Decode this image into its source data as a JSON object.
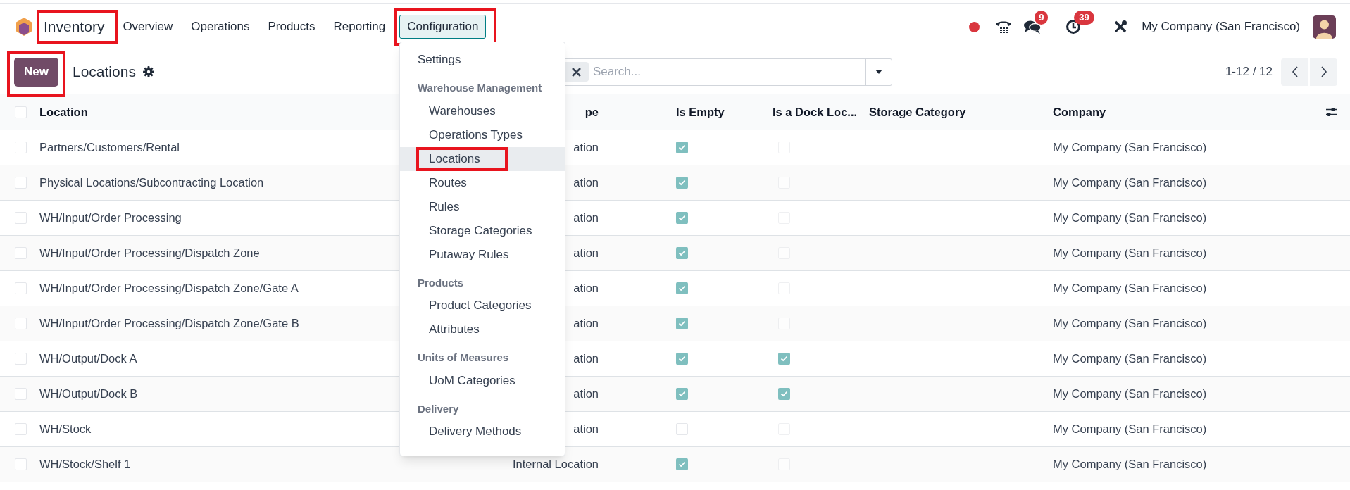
{
  "app": {
    "name": "Inventory",
    "highlighted": true
  },
  "nav": [
    {
      "label": "Overview",
      "selected": false,
      "highlighted": false
    },
    {
      "label": "Operations",
      "selected": false,
      "highlighted": false
    },
    {
      "label": "Products",
      "selected": false,
      "highlighted": false
    },
    {
      "label": "Reporting",
      "selected": false,
      "highlighted": false
    },
    {
      "label": "Configuration",
      "selected": true,
      "highlighted": true
    }
  ],
  "systray": {
    "chat_badge": "9",
    "activity_badge": "39",
    "company": "My Company (San Francisco)"
  },
  "control_panel": {
    "new_button": {
      "label": "New",
      "highlighted": true
    },
    "title": "Locations",
    "search": {
      "placeholder": "Search..."
    },
    "pager": "1-12 / 12"
  },
  "table": {
    "all_selected": false,
    "columns": [
      "Location",
      "pe",
      "Is Empty",
      "Is a Dock Loc...",
      "Storage Category",
      "Company"
    ],
    "rows": [
      {
        "selected": false,
        "location": "Partners/Customers/Rental",
        "type": "ation",
        "is_empty": true,
        "is_dock": false,
        "company": "My Company (San Francisco)"
      },
      {
        "selected": false,
        "location": "Physical Locations/Subcontracting Location",
        "type": "ation",
        "is_empty": true,
        "is_dock": false,
        "company": "My Company (San Francisco)"
      },
      {
        "selected": false,
        "location": "WH/Input/Order Processing",
        "type": "ation",
        "is_empty": true,
        "is_dock": false,
        "company": "My Company (San Francisco)"
      },
      {
        "selected": false,
        "location": "WH/Input/Order Processing/Dispatch Zone",
        "type": "ation",
        "is_empty": true,
        "is_dock": false,
        "company": "My Company (San Francisco)"
      },
      {
        "selected": false,
        "location": "WH/Input/Order Processing/Dispatch Zone/Gate A",
        "type": "ation",
        "is_empty": true,
        "is_dock": false,
        "company": "My Company (San Francisco)"
      },
      {
        "selected": false,
        "location": "WH/Input/Order Processing/Dispatch Zone/Gate B",
        "type": "ation",
        "is_empty": true,
        "is_dock": false,
        "company": "My Company (San Francisco)"
      },
      {
        "selected": false,
        "location": "WH/Output/Dock A",
        "type": "ation",
        "is_empty": true,
        "is_dock": true,
        "company": "My Company (San Francisco)"
      },
      {
        "selected": false,
        "location": "WH/Output/Dock B",
        "type": "ation",
        "is_empty": true,
        "is_dock": true,
        "company": "My Company (San Francisco)"
      },
      {
        "selected": false,
        "location": "WH/Stock",
        "type": "ation",
        "is_empty": false,
        "is_dock": false,
        "company": "My Company (San Francisco)"
      },
      {
        "selected": false,
        "location": "WH/Stock/Shelf 1",
        "type": "Internal Location",
        "is_empty": true,
        "is_dock": false,
        "company": "My Company (San Francisco)"
      }
    ]
  },
  "config_menu": {
    "items": [
      {
        "kind": "item",
        "label": "Settings",
        "selected": false,
        "highlighted": false
      },
      {
        "kind": "header",
        "label": "Warehouse Management"
      },
      {
        "kind": "subitem",
        "label": "Warehouses",
        "selected": false,
        "highlighted": false
      },
      {
        "kind": "subitem",
        "label": "Operations Types",
        "selected": false,
        "highlighted": false
      },
      {
        "kind": "subitem",
        "label": "Locations",
        "selected": true,
        "highlighted": true
      },
      {
        "kind": "subitem",
        "label": "Routes",
        "selected": false,
        "highlighted": false
      },
      {
        "kind": "subitem",
        "label": "Rules",
        "selected": false,
        "highlighted": false
      },
      {
        "kind": "subitem",
        "label": "Storage Categories",
        "selected": false,
        "highlighted": false
      },
      {
        "kind": "subitem",
        "label": "Putaway Rules",
        "selected": false,
        "highlighted": false
      },
      {
        "kind": "header",
        "label": "Products"
      },
      {
        "kind": "subitem",
        "label": "Product Categories",
        "selected": false,
        "highlighted": false
      },
      {
        "kind": "subitem",
        "label": "Attributes",
        "selected": false,
        "highlighted": false
      },
      {
        "kind": "header",
        "label": "Units of Measures"
      },
      {
        "kind": "subitem",
        "label": "UoM Categories",
        "selected": false,
        "highlighted": false
      },
      {
        "kind": "header",
        "label": "Delivery"
      },
      {
        "kind": "subitem",
        "label": "Delivery Methods",
        "selected": false,
        "highlighted": false
      }
    ]
  }
}
